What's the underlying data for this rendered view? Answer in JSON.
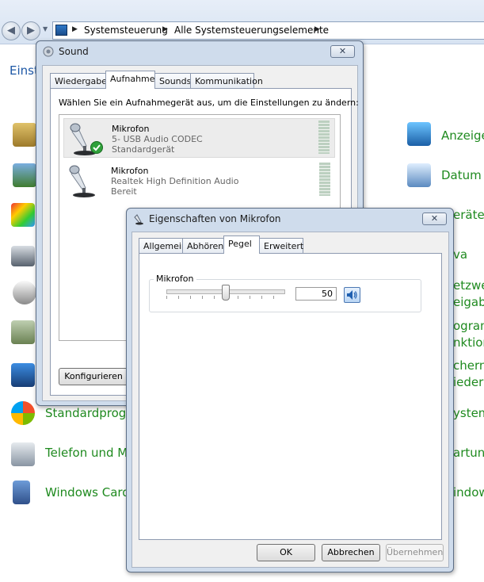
{
  "explorer": {
    "breadcrumb": [
      "Systemsteuerung",
      "Alle Systemsteuerungselemente"
    ]
  },
  "control_panel": {
    "adjust_text": "Einst",
    "left_items": [
      {
        "label": "Standardprogr",
        "icon": "default-programs-icon"
      },
      {
        "label": "Telefon und Mo",
        "icon": "phone-modem-icon"
      },
      {
        "label": "Windows Card",
        "icon": "windows-cardspace-icon"
      }
    ],
    "right_items": [
      {
        "label": "Anzeige",
        "icon": "display-icon"
      },
      {
        "label": "Datum u",
        "icon": "date-time-icon"
      },
      {
        "label": "eräte-M",
        "icon": "device-manager-icon"
      },
      {
        "label": "va",
        "icon": "java-icon"
      },
      {
        "label": "etzwer",
        "icon": "network-icon"
      },
      {
        "label": "eigabe",
        "icon": "sharing-icon"
      },
      {
        "label": "ogram",
        "icon": "programs-icon"
      },
      {
        "label": "nktion",
        "icon": "features-icon"
      },
      {
        "label": "chern",
        "icon": "backup-icon"
      },
      {
        "label": "iederh",
        "icon": "restore-icon"
      },
      {
        "label": "ystem",
        "icon": "system-icon"
      },
      {
        "label": "artung",
        "icon": "maintenance-icon"
      },
      {
        "label": "indow",
        "icon": "windows-icon"
      }
    ]
  },
  "sound_window": {
    "title": "Sound",
    "close_label": "✕",
    "tabs": [
      "Wiedergabe",
      "Aufnahme",
      "Sounds",
      "Kommunikation"
    ],
    "active_tab": "Aufnahme",
    "instruction": "Wählen Sie ein Aufnahmegerät aus, um die Einstellungen zu ändern:",
    "devices": [
      {
        "name": "Mikrofon",
        "description": "5- USB Audio CODEC",
        "status": "Standardgerät",
        "selected": true,
        "default": true
      },
      {
        "name": "Mikrofon",
        "description": "Realtek High Definition Audio",
        "status": "Bereit",
        "selected": false,
        "default": false
      }
    ],
    "configure_label": "Konfigurieren"
  },
  "props_window": {
    "title": "Eigenschaften von Mikrofon",
    "close_label": "✕",
    "tabs": [
      "Allgemein",
      "Abhören",
      "Pegel",
      "Erweitert"
    ],
    "active_tab": "Pegel",
    "group_label": "Mikrofon",
    "level_value": "50",
    "level_fraction": 0.5,
    "speaker_icon": "speaker-icon",
    "ok_label": "OK",
    "cancel_label": "Abbrechen",
    "apply_label": "Übernehmen"
  }
}
